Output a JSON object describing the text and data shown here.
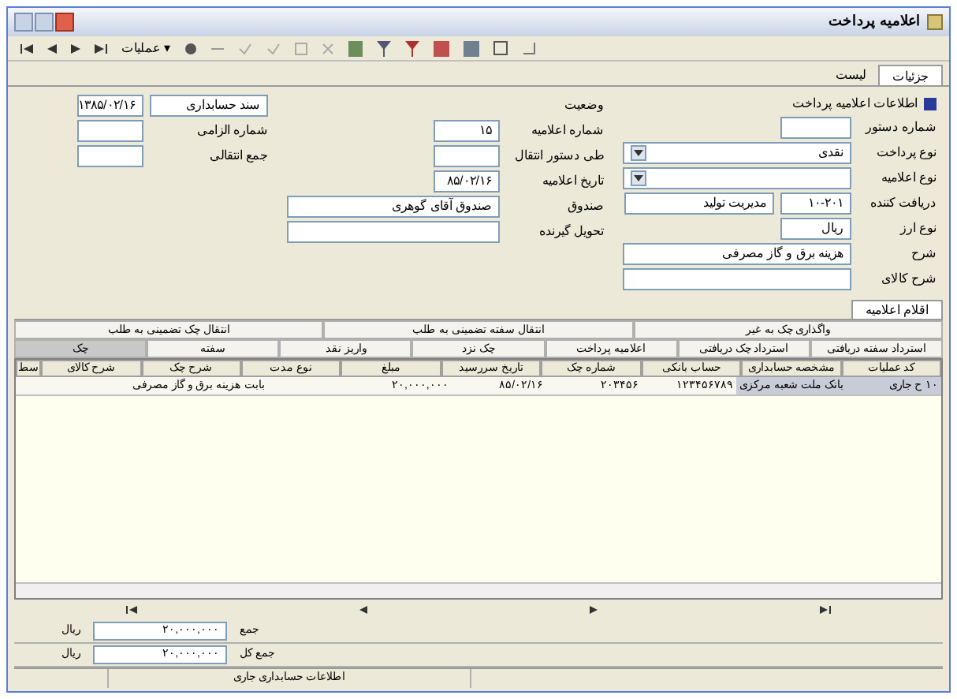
{
  "window": {
    "title": "اعلامیه پرداخت"
  },
  "toolbar": {
    "menu": "عملیات",
    "menu_caret": "▾"
  },
  "view_tabs": [
    {
      "label": "جزئیات",
      "selected": true
    },
    {
      "label": "لیست",
      "selected": false
    }
  ],
  "section": {
    "title": "اطلاعات اعلامیه پرداخت",
    "expanded": true
  },
  "form_right": [
    {
      "label": "شماره دستور",
      "kind": "short"
    },
    {
      "label": "نوع پرداخت",
      "value": "نقدی",
      "kind": "combo"
    },
    {
      "label": "نوع اعلامیه",
      "kind": "combo"
    },
    {
      "label": "دریافت کننده",
      "value": "۱۰-۲۰۱",
      "extra": "مدیریت تولید",
      "kind": "pair"
    },
    {
      "label": "نوع ارز",
      "value": "ریال",
      "kind": "short"
    },
    {
      "label": "شرح",
      "value": "هزینه برق و گاز مصرفی",
      "kind": "wide"
    },
    {
      "label": "شرح کالای",
      "kind": "wide"
    }
  ],
  "form_middle": [
    {
      "label": "وضعیت"
    },
    {
      "label": "شماره اعلامیه",
      "value": "۱۵"
    },
    {
      "label": "طی دستور انتقال"
    },
    {
      "label": "تاریخ اعلامیه",
      "value": "۸۵/۰۲/۱۶"
    },
    {
      "label": "صندوق",
      "value": "صندوق آقای گوهری"
    },
    {
      "label": "تحویل گیرنده"
    }
  ],
  "form_left": [
    {
      "label": "سند حسابداری",
      "value": "۱۳۸۵/۰۲/۱۶"
    },
    {
      "label": "شماره الزامی"
    },
    {
      "label": "جمع انتقالی"
    }
  ],
  "items_tab": {
    "label": "اقلام اعلامیه"
  },
  "op_tabs_top": [
    {
      "label": "واگذاری چک به غیر",
      "selected": false
    },
    {
      "label": "انتقال سفته تضمینی به طلب",
      "selected": false
    },
    {
      "label": "انتقال چک تضمینی به طلب",
      "selected": false
    }
  ],
  "op_tabs": [
    {
      "label": "استرداد سفته دریافتی",
      "selected": false
    },
    {
      "label": "استرداد چک دریافتی",
      "selected": false
    },
    {
      "label": "اعلامیه پرداخت",
      "selected": false
    },
    {
      "label": "چک نزد",
      "selected": false
    },
    {
      "label": "واریز نقد",
      "selected": false
    },
    {
      "label": "سفته",
      "selected": false
    },
    {
      "label": "چک",
      "selected": true
    }
  ],
  "table": {
    "columns": [
      "کد عملیات",
      "مشخصه حسابداری",
      "حساب بانکی",
      "شماره چک",
      "تاریخ سررسید",
      "مبلغ",
      "نوع مدت",
      "شرح چک",
      "شرح کالای",
      "سط"
    ],
    "rows": [
      {
        "selected": true,
        "cells": [
          "۱۰ ح جاری",
          "بانک ملت شعبه مرکزی",
          "۱۲۳۴۵۶۷۸۹",
          "۲۰۳۴۵۶",
          "۸۵/۰۲/۱۶",
          "۲۰,۰۰۰,۰۰۰",
          null,
          "بابت هزینه برق و گاز مصرفی",
          null,
          null
        ]
      }
    ]
  },
  "totals": [
    {
      "label": "جمع",
      "value": "۲۰,۰۰۰,۰۰۰",
      "unit": "ریال"
    },
    {
      "label": "جمع کل",
      "value": "۲۰,۰۰۰,۰۰۰",
      "unit": "ریال"
    }
  ],
  "status_bar": {
    "text": "اطلاعات حسابداری جاری"
  }
}
